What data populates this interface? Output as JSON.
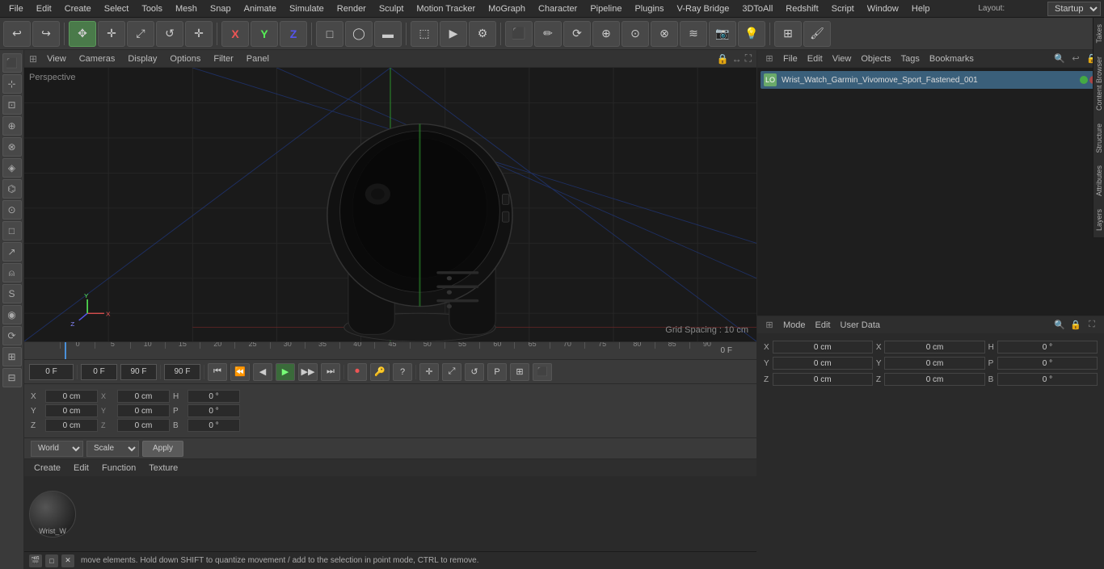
{
  "menubar": {
    "items": [
      "File",
      "Edit",
      "Create",
      "Select",
      "Tools",
      "Mesh",
      "Snap",
      "Animate",
      "Simulate",
      "Render",
      "Sculpt",
      "Motion Tracker",
      "MoGraph",
      "Character",
      "Pipeline",
      "Plugins",
      "V-Ray Bridge",
      "3DToAll",
      "Redshift",
      "Script",
      "Window",
      "Help"
    ],
    "layout_label": "Layout:",
    "layout_value": "Startup"
  },
  "toolbar": {
    "undo_label": "↩",
    "redo_label": "↪",
    "buttons": [
      "✥",
      "+",
      "□",
      "↺",
      "+",
      "X",
      "Y",
      "Z",
      "◨",
      "⬛",
      "▶▶",
      "▶",
      "⬜",
      "◩",
      "⬛",
      "▦",
      "◎",
      "🔒",
      "⊙",
      "◯",
      "▪",
      "●"
    ]
  },
  "viewport": {
    "header_items": [
      "View",
      "Cameras",
      "Display",
      "Options",
      "Filter",
      "Panel"
    ],
    "label": "Perspective",
    "grid_spacing": "Grid Spacing : 10 cm",
    "timeline_ticks": [
      "0",
      "5",
      "10",
      "15",
      "20",
      "25",
      "30",
      "35",
      "40",
      "45",
      "50",
      "55",
      "60",
      "65",
      "70",
      "75",
      "80",
      "85",
      "90"
    ],
    "frame_indicator": "0 F"
  },
  "transport": {
    "current_frame": "0 F",
    "frame_start": "0 F",
    "frame_end": "90 F",
    "frame_end2": "90 F"
  },
  "objects_panel": {
    "menu_items": [
      "File",
      "Edit",
      "View",
      "Objects",
      "Tags",
      "Bookmarks"
    ],
    "object_name": "Wrist_Watch_Garmin_Vivomove_Sport_Fastened_001"
  },
  "attributes_panel": {
    "menu_items": [
      "Mode",
      "Edit",
      "User Data"
    ],
    "coords": {
      "x_pos": "0 cm",
      "y_pos": "0 cm",
      "z_pos": "0 cm",
      "x_rot": "0 cm",
      "y_rot": "0 cm",
      "z_rot": "0 cm",
      "h": "0 °",
      "p": "0 °",
      "b": "0 °"
    }
  },
  "coord_bar": {
    "x_label": "X",
    "y_label": "Y",
    "z_label": "Z",
    "x_val": "0 cm",
    "y_val": "0 cm",
    "z_val": "0 cm",
    "x_val2": "0 cm",
    "y_val2": "0 cm",
    "z_val2": "0 cm",
    "h_label": "H",
    "p_label": "P",
    "b_label": "B",
    "h_val": "0 °",
    "p_val": "0 °",
    "b_val": "0 °"
  },
  "world_bar": {
    "world_label": "World",
    "scale_label": "Scale",
    "apply_label": "Apply"
  },
  "material": {
    "menu_items": [
      "Create",
      "Edit",
      "Function",
      "Texture"
    ],
    "name": "Wrist_W"
  },
  "status_bar": {
    "text": "move elements. Hold down SHIFT to quantize movement / add to the selection in point mode, CTRL to remove."
  },
  "right_tabs": [
    "Takes",
    "Content Browser",
    "Structure",
    "Attributes",
    "Layers"
  ]
}
